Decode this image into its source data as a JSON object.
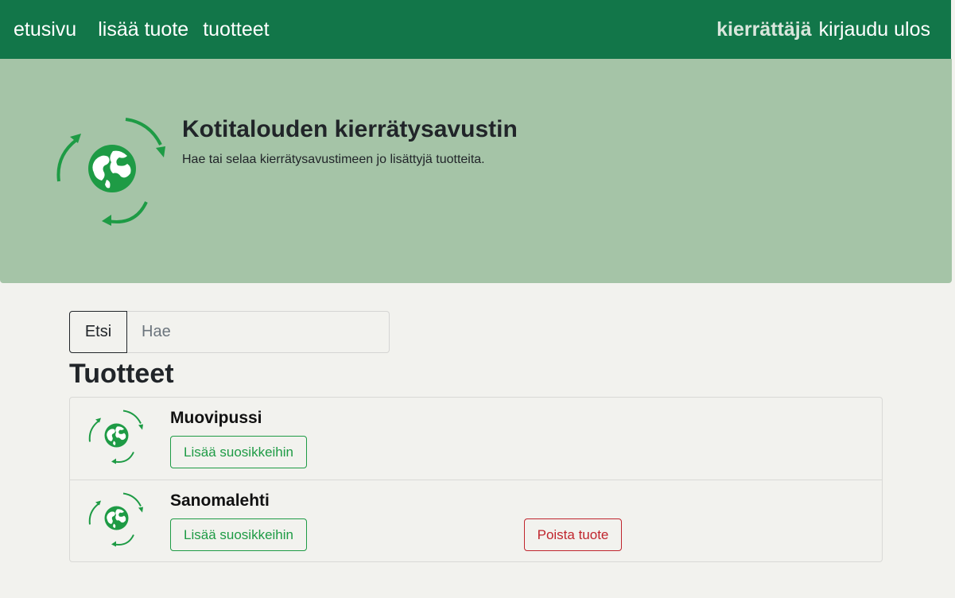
{
  "nav": {
    "home": "etusivu",
    "add_product": "lisää tuote",
    "products": "tuotteet",
    "user": "kierrättäjä",
    "logout": "kirjaudu ulos"
  },
  "hero": {
    "title": "Kotitalouden kierrätysavustin",
    "subtitle": "Hae tai selaa kierrätysavustimeen jo lisättyjä tuotteita.",
    "logo_icon": "recycle-globe-icon"
  },
  "search": {
    "button_label": "Etsi",
    "placeholder": "Hae",
    "value": ""
  },
  "products_heading": "Tuotteet",
  "products": [
    {
      "name": "Muovipussi",
      "favorite_label": "Lisää suosikkeihin",
      "delete_label": ""
    },
    {
      "name": "Sanomalehti",
      "favorite_label": "Lisää suosikkeihin",
      "delete_label": "Poista tuote"
    }
  ],
  "colors": {
    "navbar": "#127649",
    "hero": "#a5c4a7",
    "background": "#f2f2ee",
    "accent_green": "#1e9b45",
    "danger_red": "#c0252d"
  }
}
